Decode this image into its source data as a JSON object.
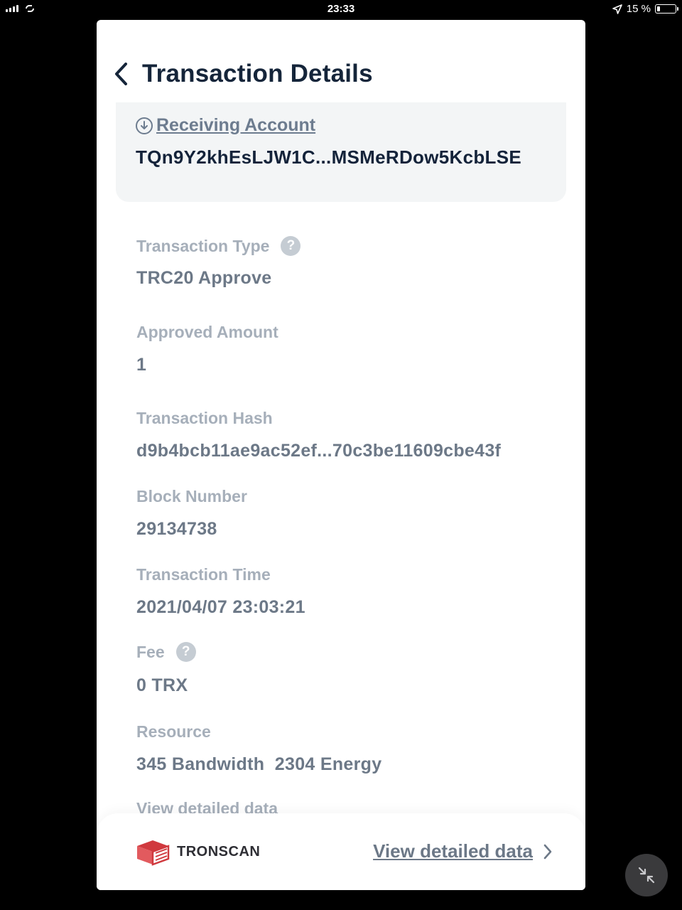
{
  "status_bar": {
    "time": "23:33",
    "battery": "15 %"
  },
  "header": {
    "title": "Transaction Details",
    "back_icon": "chevron-left-icon"
  },
  "receiving_account": {
    "label": "Receiving Account",
    "address": "TQn9Y2khEsLJW1C...MSMeRDow5KcbLSE",
    "icon": "download-circle-icon"
  },
  "fields": [
    {
      "label": "Transaction Type",
      "value": "TRC20 Approve",
      "help": true
    },
    {
      "label": "Approved Amount",
      "value": "1",
      "help": false
    },
    {
      "label": "Transaction Hash",
      "value": "d9b4bcb11ae9ac52ef...70c3be11609cbe43f",
      "help": false
    },
    {
      "label": "Block Number",
      "value": "29134738",
      "help": false
    },
    {
      "label": "Transaction Time",
      "value": "2021/04/07 23:03:21",
      "help": false
    },
    {
      "label": "Fee",
      "value": "0 TRX",
      "help": true
    },
    {
      "label": "Resource",
      "value": "345 Bandwidth  2304 Energy",
      "help": false
    }
  ],
  "help_glyph": "?",
  "faded_text": "View detailed data",
  "footer": {
    "logo_text": "TRONSCAN",
    "link_label": "View detailed data"
  },
  "colors": {
    "title": "#15253a",
    "label": "#a6afba",
    "value": "#6c7887",
    "brand": "#d0393e"
  }
}
